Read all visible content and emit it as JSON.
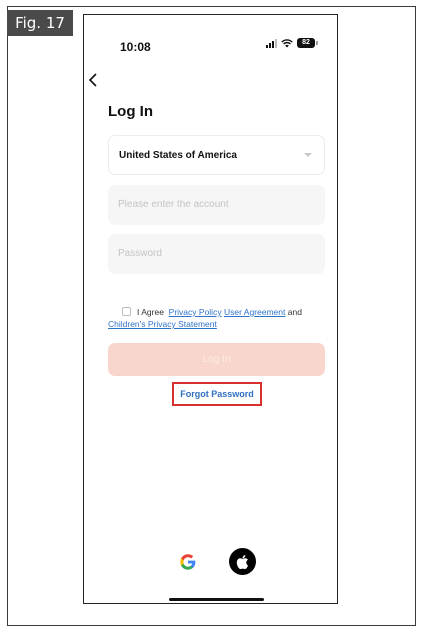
{
  "figure": {
    "label": "Fig. 17"
  },
  "status_bar": {
    "time": "10:08",
    "battery": "82",
    "icons": [
      "signal-icon",
      "wifi-icon",
      "battery-icon"
    ]
  },
  "nav": {
    "back_icon": "chevron-left-icon"
  },
  "login": {
    "title": "Log In",
    "country": "United States of America",
    "account_placeholder": "Please enter the account",
    "password_placeholder": "Password",
    "agree_prefix": "I Agree",
    "privacy_policy": "Privacy Policy",
    "user_agreement": "User Agreement",
    "and": "and",
    "childrens_privacy": "Children's Privacy Statement",
    "login_button": "Log In",
    "forgot_password": "Forgot Password"
  },
  "social": {
    "google_letter": "G",
    "icons": [
      "google-icon",
      "apple-icon"
    ]
  },
  "colors": {
    "accent_button": "#f8d6cd",
    "link": "#2f73c9",
    "highlight_box": "#d9302f"
  }
}
